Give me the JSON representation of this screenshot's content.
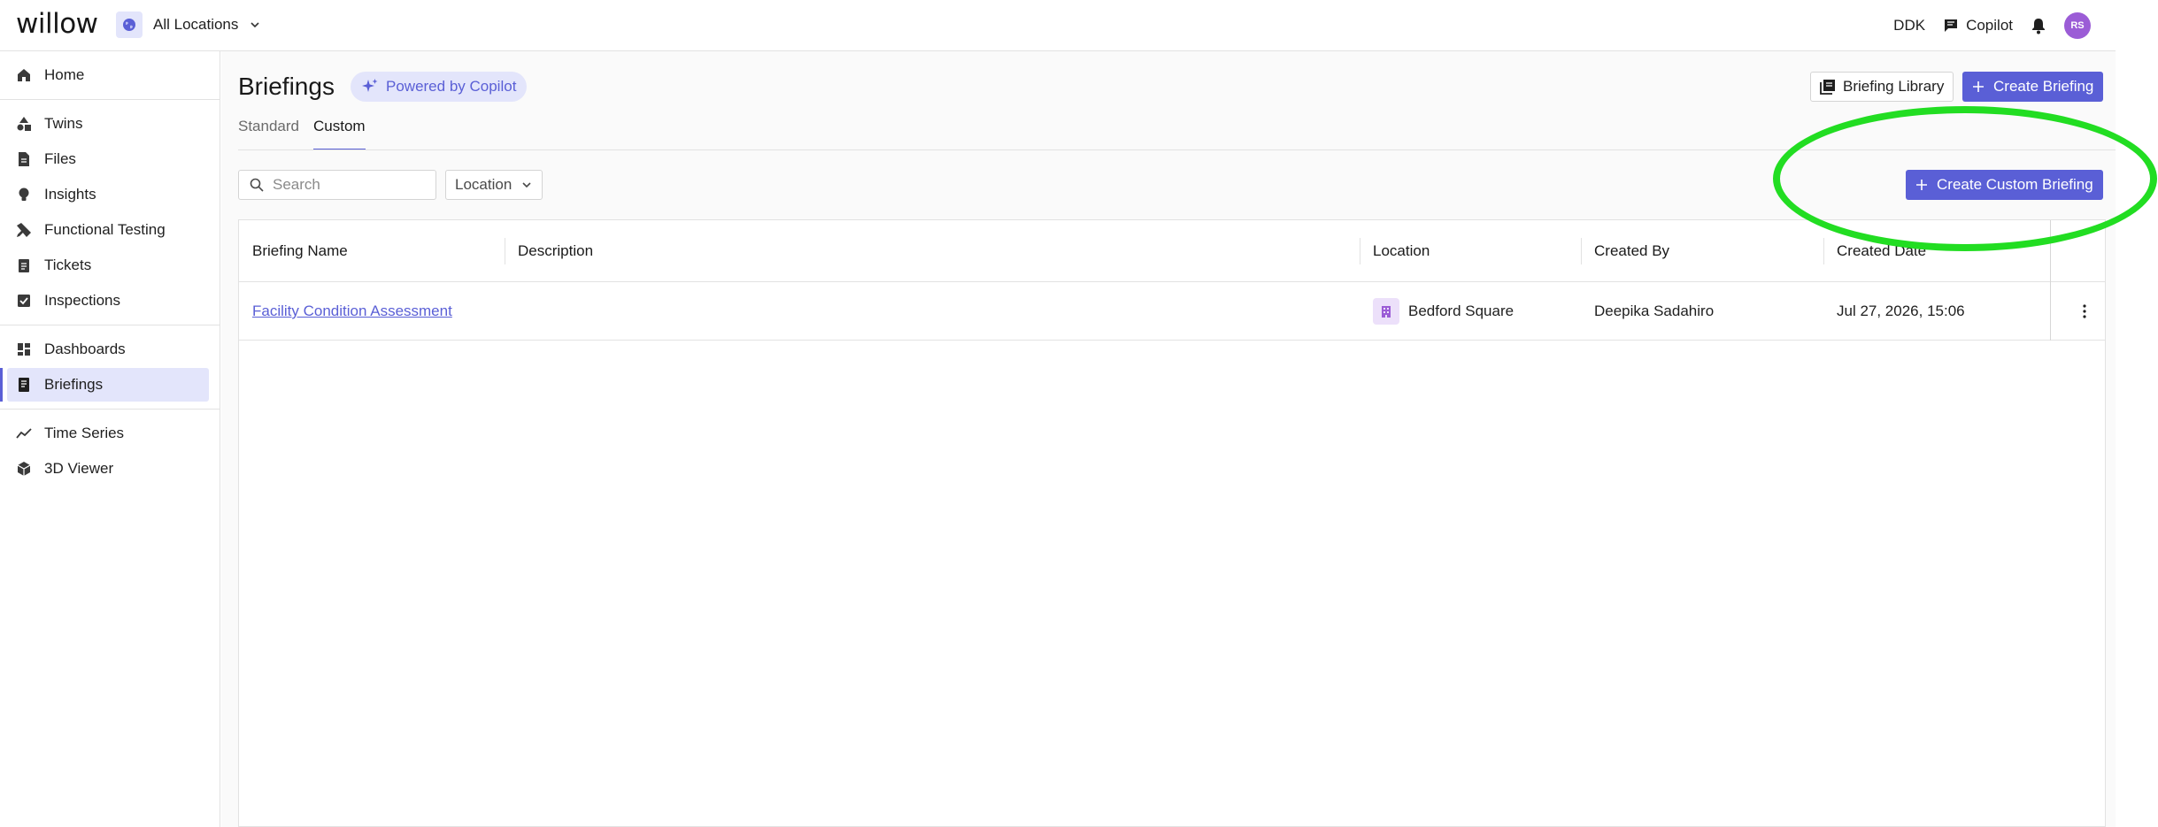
{
  "app": {
    "logo": "willow"
  },
  "topbar": {
    "location_label": "All Locations",
    "user_code": "DDK",
    "copilot_label": "Copilot",
    "avatar_initials": "RS"
  },
  "sidebar": {
    "groups": [
      [
        {
          "label": "Home",
          "icon": "home-icon"
        }
      ],
      [
        {
          "label": "Twins",
          "icon": "shapes-icon"
        },
        {
          "label": "Files",
          "icon": "file-icon"
        },
        {
          "label": "Insights",
          "icon": "lightbulb-icon"
        },
        {
          "label": "Functional Testing",
          "icon": "pencil-ruler-icon"
        },
        {
          "label": "Tickets",
          "icon": "clipboard-icon"
        },
        {
          "label": "Inspections",
          "icon": "checkbox-icon"
        }
      ],
      [
        {
          "label": "Dashboards",
          "icon": "dashboard-icon"
        },
        {
          "label": "Briefings",
          "icon": "briefing-icon",
          "active": true
        }
      ],
      [
        {
          "label": "Time Series",
          "icon": "line-chart-icon"
        },
        {
          "label": "3D Viewer",
          "icon": "cube-icon"
        }
      ]
    ]
  },
  "page": {
    "title": "Briefings",
    "powered_by": "Powered by Copilot",
    "library_button": "Briefing Library",
    "create_button": "Create Briefing",
    "tabs": [
      {
        "label": "Standard",
        "active": false
      },
      {
        "label": "Custom",
        "active": true
      }
    ],
    "search_placeholder": "Search",
    "location_filter": "Location",
    "create_custom_button": "Create Custom Briefing"
  },
  "table": {
    "columns": [
      "Briefing Name",
      "Description",
      "Location",
      "Created By",
      "Created Date"
    ],
    "rows": [
      {
        "name": "Facility Condition Assessment",
        "description": "",
        "location": "Bedford Square",
        "created_by": "Deepika Sadahiro",
        "created_date": "Jul 27, 2026, 15:06"
      }
    ]
  },
  "colors": {
    "accent": "#5a5fd6",
    "accent_light": "#e3e5fb",
    "avatar": "#9b5cd6",
    "annotation": "#22dd22"
  }
}
